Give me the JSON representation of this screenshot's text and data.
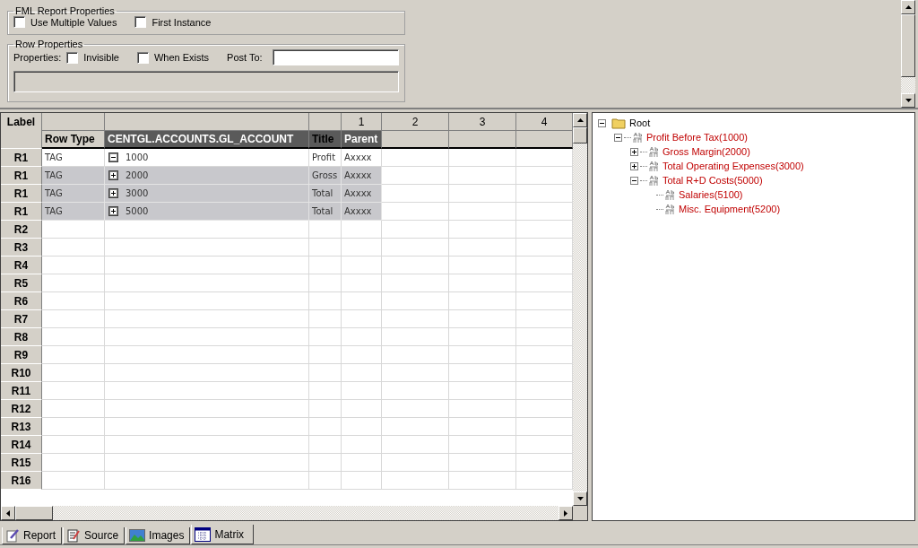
{
  "fml_report_properties": {
    "title": "FML Report Properties",
    "options": [
      {
        "label": "Use Multiple Values",
        "checked": false
      },
      {
        "label": "First Instance",
        "checked": false
      }
    ]
  },
  "row_properties": {
    "title": "Row Properties",
    "properties_label": "Properties:",
    "options": [
      {
        "label": "Invisible",
        "checked": false
      },
      {
        "label": "When Exists",
        "checked": false
      }
    ],
    "post_to_label": "Post To:"
  },
  "grid": {
    "corner": "Label",
    "columns": [
      {
        "label": "Row Type",
        "selected": false
      },
      {
        "label": "CENTGL.ACCOUNTS.GL_ACCOUNT",
        "selected": true
      },
      {
        "label": "Title",
        "selected": true
      },
      {
        "number": "1",
        "label": "Parent",
        "selected": true
      },
      {
        "number": "2",
        "selected": false
      },
      {
        "number": "3",
        "selected": false
      },
      {
        "number": "4",
        "selected": false
      }
    ],
    "rows": [
      {
        "label": "R1",
        "row_type": "TAG",
        "account": "1000",
        "expanded": true,
        "title": "Profit",
        "parent": "Axxxx",
        "selected": false
      },
      {
        "label": "R1",
        "row_type": "TAG",
        "account": "2000",
        "expanded": false,
        "title": "Gross",
        "parent": "Axxxx",
        "selected": true
      },
      {
        "label": "R1",
        "row_type": "TAG",
        "account": "3000",
        "expanded": false,
        "title": "Total",
        "parent": "Axxxx",
        "selected": true
      },
      {
        "label": "R1",
        "row_type": "TAG",
        "account": "5000",
        "expanded": false,
        "title": "Total",
        "parent": "Axxxx",
        "selected": true
      },
      {
        "label": "R2"
      },
      {
        "label": "R3"
      },
      {
        "label": "R4"
      },
      {
        "label": "R5"
      },
      {
        "label": "R6"
      },
      {
        "label": "R7"
      },
      {
        "label": "R8"
      },
      {
        "label": "R9"
      },
      {
        "label": "R10"
      },
      {
        "label": "R11"
      },
      {
        "label": "R12"
      },
      {
        "label": "R13"
      },
      {
        "label": "R14"
      },
      {
        "label": "R15"
      },
      {
        "label": "R16"
      }
    ]
  },
  "tree": [
    {
      "label": "Root",
      "kind": "folder",
      "expanded": true,
      "children": [
        {
          "label": "Profit Before Tax(1000)",
          "kind": "item",
          "expanded": true,
          "children": [
            {
              "label": "Gross Margin(2000)",
              "kind": "item",
              "expanded": false
            },
            {
              "label": "Total Operating Expenses(3000)",
              "kind": "item",
              "expanded": false
            },
            {
              "label": "Total R+D Costs(5000)",
              "kind": "item",
              "expanded": true,
              "children": [
                {
                  "label": "Salaries(5100)",
                  "kind": "item"
                },
                {
                  "label": "Misc. Equipment(5200)",
                  "kind": "item"
                }
              ]
            }
          ]
        }
      ]
    }
  ],
  "tabs": [
    {
      "label": "Report",
      "kind": "report",
      "selected": false
    },
    {
      "label": "Source",
      "kind": "source",
      "selected": false
    },
    {
      "label": "Images",
      "kind": "images",
      "selected": false
    },
    {
      "label": "Matrix",
      "kind": "matrix",
      "selected": true
    }
  ]
}
